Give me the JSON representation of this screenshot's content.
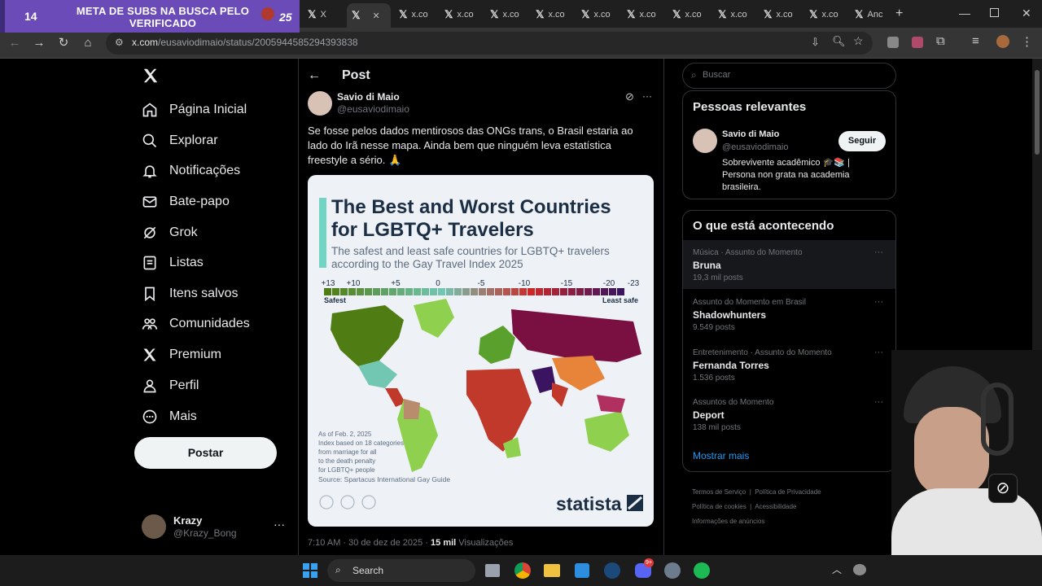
{
  "browser": {
    "promo": {
      "count": "14",
      "text": "META DE SUBS NA BUSCA PELO VERIFICADO",
      "badge": "25"
    },
    "tabs": [
      {
        "label": "X",
        "active": false
      },
      {
        "label": "",
        "active": true
      },
      {
        "label": "x.co",
        "active": false
      },
      {
        "label": "x.co",
        "active": false
      },
      {
        "label": "x.co",
        "active": false
      },
      {
        "label": "x.co",
        "active": false
      },
      {
        "label": "x.co",
        "active": false
      },
      {
        "label": "x.co",
        "active": false
      },
      {
        "label": "x.co",
        "active": false
      },
      {
        "label": "x.co",
        "active": false
      },
      {
        "label": "x.co",
        "active": false
      },
      {
        "label": "x.co",
        "active": false
      },
      {
        "label": "Anc",
        "active": false
      }
    ],
    "url_host": "x.com",
    "url_path": "/eusaviodimaio/status/2005944585294393838"
  },
  "nav": {
    "items": [
      {
        "label": "Página Inicial",
        "icon": "home-icon"
      },
      {
        "label": "Explorar",
        "icon": "search-icon"
      },
      {
        "label": "Notificações",
        "icon": "bell-icon"
      },
      {
        "label": "Bate-papo",
        "icon": "mail-icon"
      },
      {
        "label": "Grok",
        "icon": "grok-icon"
      },
      {
        "label": "Listas",
        "icon": "list-icon"
      },
      {
        "label": "Itens salvos",
        "icon": "bookmark-icon"
      },
      {
        "label": "Comunidades",
        "icon": "communities-icon"
      },
      {
        "label": "Premium",
        "icon": "x-logo-icon"
      },
      {
        "label": "Perfil",
        "icon": "person-icon"
      },
      {
        "label": "Mais",
        "icon": "more-circle-icon"
      }
    ],
    "post_label": "Postar",
    "account": {
      "name": "Krazy",
      "handle": "@Krazy_Bong"
    }
  },
  "post": {
    "header": "Post",
    "author": "Savio di Maio",
    "handle": "@eusaviodimaio",
    "text": "Se fosse pelos dados mentirosos das ONGs trans, o Brasil estaria ao lado do Irã nesse mapa. Ainda bem que ninguém leva estatística freestyle a sério. 🙏",
    "time": "7:10 AM · 30 de dez de 2025 · ",
    "views_count": "15 mil",
    "views_label": " Visualizações"
  },
  "chart": {
    "title_line1": "The Best and Worst Countries",
    "title_line2": "for LGBTQ+ Travelers",
    "subtitle_line1": "The safest and least safe countries for LGBTQ+ travelers",
    "subtitle_line2": "according to the Gay Travel Index 2025",
    "scale_ticks": [
      "+13",
      "+10",
      "+5",
      "0",
      "-5",
      "-10",
      "-15",
      "-20",
      "-23"
    ],
    "scale_left": "Safest",
    "scale_right": "Least safe",
    "note_line1": "As of Feb. 2, 2025",
    "note_line2": "Index based on 18 categories",
    "note_line3": "from marriage for all",
    "note_line4": "to the death penalty",
    "note_line5": "for LGBTQ+ people",
    "source": "Source: Spartacus International Gay Guide",
    "brand": "statista",
    "colors": {
      "safest": "#4f7d13",
      "neutral": "#72c7b3",
      "least_safe": "#3a1460"
    }
  },
  "sidebar": {
    "search_placeholder": "Buscar",
    "relevant_title": "Pessoas relevantes",
    "relevant_name": "Savio di Maio",
    "relevant_handle": "@eusaviodimaio",
    "follow_label": "Seguir",
    "bio_line1": "Sobrevivente acadêmico 🎓📚 |",
    "bio_line2": "Persona non grata na academia",
    "bio_line3": "brasileira.",
    "trends_title": "O que está acontecendo",
    "trends": [
      {
        "context": "Música · Assunto do Momento",
        "name": "Bruna",
        "posts": "19,3 mil posts"
      },
      {
        "context": "Assunto do Momento em Brasil",
        "name": "Shadowhunters",
        "posts": "9.549 posts"
      },
      {
        "context": "Entretenimento · Assunto do Momento",
        "name": "Fernanda Torres",
        "posts": "1.536 posts"
      },
      {
        "context": "Assuntos do Momento",
        "name": "Deport",
        "posts": "138 mil posts"
      }
    ],
    "show_more": "Mostrar mais",
    "footer_links": [
      "Termos de Serviço",
      "Política de Privacidade",
      "Política de cookies",
      "Acessibilidade",
      "Informações de anúncios"
    ]
  },
  "taskbar": {
    "search_label": "Search",
    "discord_badge": "9+"
  }
}
